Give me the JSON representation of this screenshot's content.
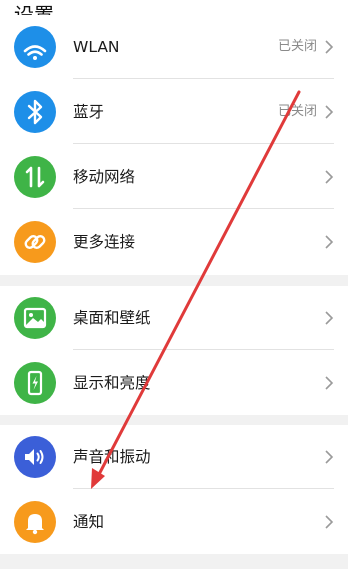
{
  "header": {
    "title": "设置"
  },
  "colors": {
    "blue": "#1e8fe8",
    "green": "#3fb447",
    "orange": "#f79a1c",
    "indigo": "#3b5fd8",
    "annotation_arrow": "#e03a3a"
  },
  "groups": [
    {
      "items": [
        {
          "label": "WLAN",
          "status": "已关闭",
          "icon": "wifi-icon",
          "icon_color": "#1e8fe8"
        },
        {
          "label": "蓝牙",
          "status": "已关闭",
          "icon": "bluetooth-icon",
          "icon_color": "#1e8fe8"
        },
        {
          "label": "移动网络",
          "status": "",
          "icon": "mobile-data-icon",
          "icon_color": "#3fb447"
        },
        {
          "label": "更多连接",
          "status": "",
          "icon": "link-icon",
          "icon_color": "#f79a1c"
        }
      ]
    },
    {
      "items": [
        {
          "label": "桌面和壁纸",
          "status": "",
          "icon": "wallpaper-icon",
          "icon_color": "#3fb447"
        },
        {
          "label": "显示和亮度",
          "status": "",
          "icon": "display-brightness-icon",
          "icon_color": "#3fb447"
        }
      ]
    },
    {
      "items": [
        {
          "label": "声音和振动",
          "status": "",
          "icon": "speaker-icon",
          "icon_color": "#3b5fd8"
        },
        {
          "label": "通知",
          "status": "",
          "icon": "bell-icon",
          "icon_color": "#f79a1c"
        }
      ]
    }
  ]
}
